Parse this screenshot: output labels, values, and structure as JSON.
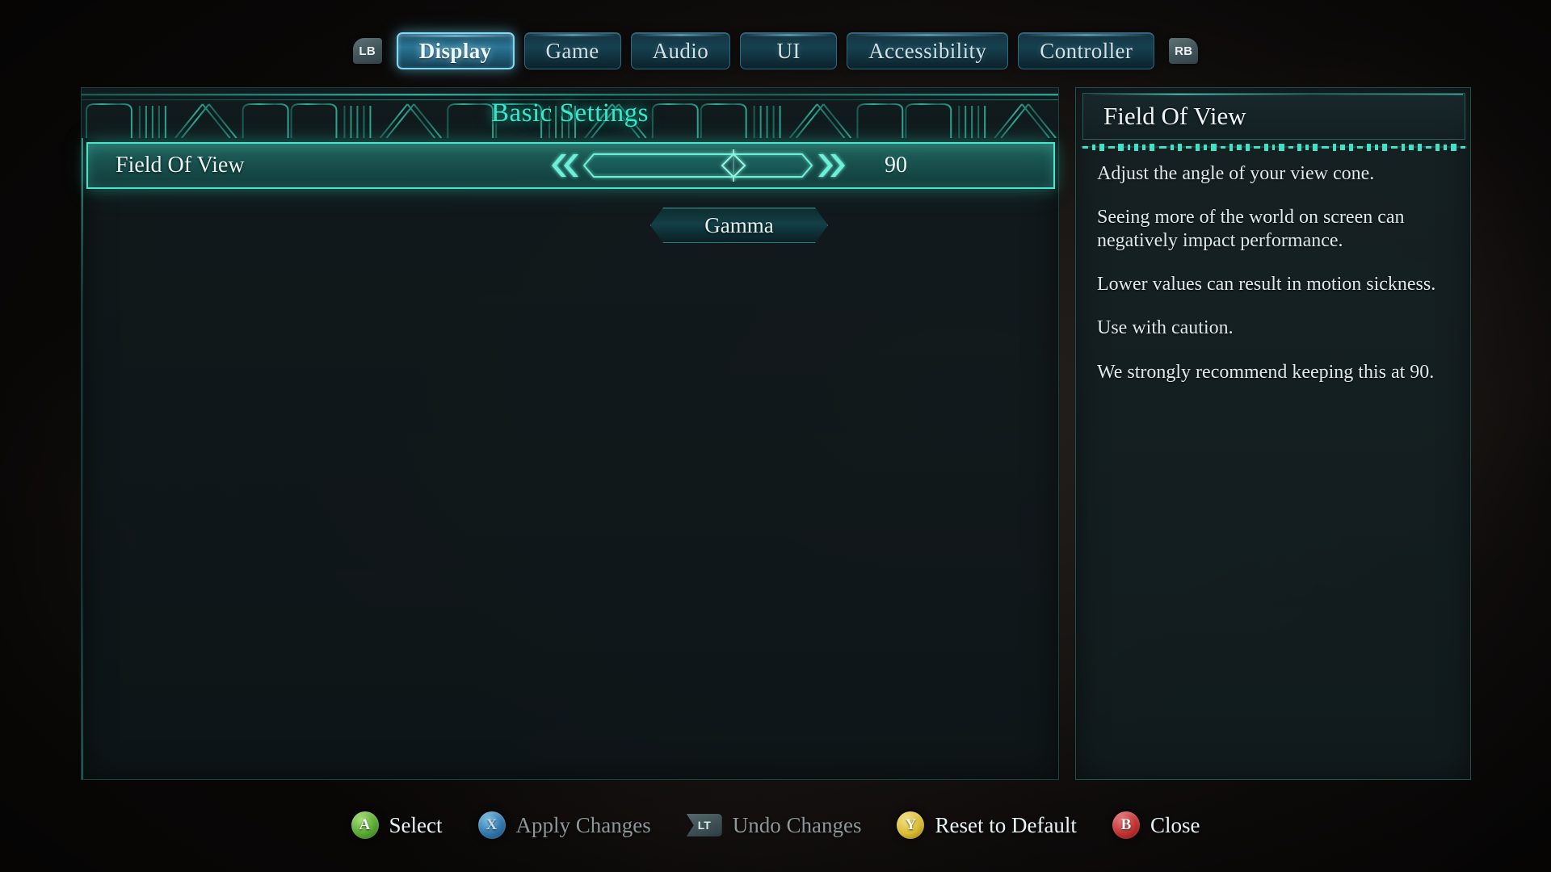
{
  "tabbar": {
    "left_bumper": "LB",
    "right_bumper": "RB",
    "tabs": [
      {
        "label": "Display",
        "selected": true
      },
      {
        "label": "Game",
        "selected": false
      },
      {
        "label": "Audio",
        "selected": false
      },
      {
        "label": "UI",
        "selected": false
      },
      {
        "label": "Accessibility",
        "selected": false
      },
      {
        "label": "Controller",
        "selected": false
      }
    ]
  },
  "left_panel": {
    "section_title": "Basic Settings",
    "settings": [
      {
        "label": "Field Of View",
        "type": "slider",
        "value": "90",
        "fill_percent": 66,
        "selected": true
      }
    ],
    "gamma_button": "Gamma"
  },
  "right_panel": {
    "title": "Field Of View",
    "paragraphs": [
      "Adjust the angle of your view cone.",
      "Seeing more of the world on screen can negatively impact performance.",
      "Lower values can result in motion sickness.",
      "Use with caution.",
      "We strongly recommend keeping this at 90."
    ]
  },
  "prompts": [
    {
      "glyph": "A",
      "glyph_kind": "face",
      "label": "Select",
      "disabled": false
    },
    {
      "glyph": "X",
      "glyph_kind": "face",
      "label": "Apply Changes",
      "disabled": true
    },
    {
      "glyph": "LT",
      "glyph_kind": "trigger",
      "label": "Undo Changes",
      "disabled": true
    },
    {
      "glyph": "Y",
      "glyph_kind": "face",
      "label": "Reset to Default",
      "disabled": false
    },
    {
      "glyph": "B",
      "glyph_kind": "face",
      "label": "Close",
      "disabled": false
    }
  ],
  "colors": {
    "accent_teal": "#39e8cd",
    "accent_cyan": "#7fd9f2",
    "row_highlight": "#47e6cb",
    "text_light": "#e8f3f6",
    "panel_bg": "#111a1d"
  }
}
